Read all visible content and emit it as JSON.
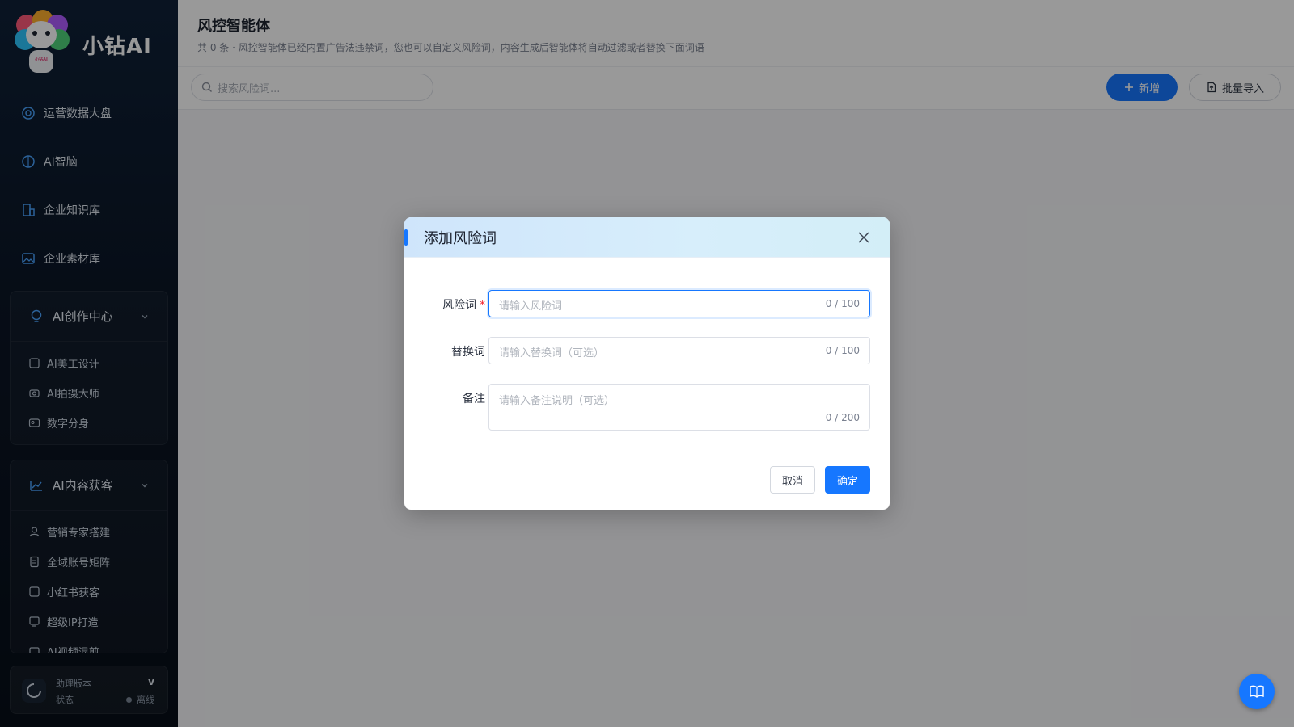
{
  "sidebar": {
    "brand": "小钻AI",
    "logo_badge": "小钻AI",
    "nav": [
      {
        "label": "运营数据大盘",
        "icon": "dashboard-icon"
      },
      {
        "label": "AI智脑",
        "icon": "brain-icon"
      },
      {
        "label": "企业知识库",
        "icon": "building-icon"
      },
      {
        "label": "企业素材库",
        "icon": "image-icon"
      }
    ],
    "groups": [
      {
        "label": "AI创作中心",
        "icon": "bulb-icon",
        "items": [
          {
            "label": "AI美工设计",
            "icon": "palette-icon"
          },
          {
            "label": "AI拍摄大师",
            "icon": "camera-icon"
          },
          {
            "label": "数字分身",
            "icon": "id-card-icon"
          }
        ]
      },
      {
        "label": "AI内容获客",
        "icon": "trend-icon",
        "items": [
          {
            "label": "营销专家搭建",
            "icon": "user-icon"
          },
          {
            "label": "全域账号矩阵",
            "icon": "document-icon"
          },
          {
            "label": "小红书获客",
            "icon": "ai-badge-icon"
          },
          {
            "label": "超级IP打造",
            "icon": "monitor-user-icon"
          },
          {
            "label": "AI视频混剪",
            "icon": "video-icon"
          }
        ]
      }
    ],
    "version": {
      "label": "助理版本",
      "value": "v",
      "status_label": "状态",
      "status_value": "离线"
    }
  },
  "page": {
    "title": "风控智能体",
    "description": "共 0 条 · 风控智能体已经内置广告法违禁词，您也可以自定义风险词，内容生成后智能体将自动过滤或者替换下面词语"
  },
  "toolbar": {
    "search_placeholder": "搜索风险词...",
    "add_label": "新增",
    "import_label": "批量导入"
  },
  "modal": {
    "title": "添加风险词",
    "fields": [
      {
        "label": "风险词",
        "required_mark": "*",
        "placeholder": "请输入风险词",
        "counter": "0 / 100"
      },
      {
        "label": "替换词",
        "placeholder": "请输入替换词（可选）",
        "counter": "0 / 100"
      },
      {
        "label": "备注",
        "placeholder": "请输入备注说明（可选）",
        "counter": "0 / 200"
      }
    ],
    "cancel_label": "取消",
    "confirm_label": "确定"
  },
  "colors": {
    "primary": "#1677ff",
    "sidebar_bg": "#0b1626",
    "required": "#f5222d"
  }
}
